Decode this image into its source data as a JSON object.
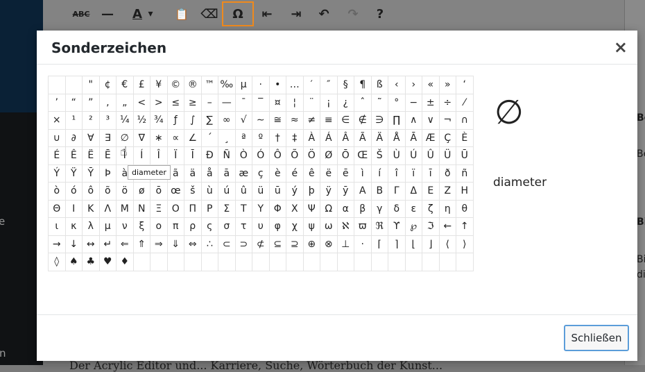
{
  "toolbar": {
    "buttons": [
      {
        "name": "strikethrough-button",
        "glyph": "ABC"
      },
      {
        "name": "horizontal-line-button",
        "glyph": "—"
      },
      {
        "name": "text-color-button",
        "glyph": "A"
      },
      {
        "name": "text-color-dropdown",
        "glyph": "▾"
      },
      {
        "name": "paste-as-text-button",
        "glyph": "📋"
      },
      {
        "name": "clear-formatting-button",
        "glyph": "⌫"
      },
      {
        "name": "special-character-button",
        "glyph": "Ω"
      },
      {
        "name": "decrease-indent-button",
        "glyph": "⇤"
      },
      {
        "name": "increase-indent-button",
        "glyph": "⇥"
      },
      {
        "name": "undo-button",
        "glyph": "↶"
      },
      {
        "name": "redo-button",
        "glyph": "↷"
      },
      {
        "name": "help-button",
        "glyph": "?"
      }
    ]
  },
  "background": {
    "right_letters": [
      "Be",
      "Be",
      "Bi",
      "Bi",
      "di"
    ],
    "sidebar_letters": [
      "e",
      "n"
    ],
    "bottom_text": "Der Acrylic Editor und... Karriere, Suche, Wörterbuch der Kunst..."
  },
  "dialog": {
    "title": "Sonderzeichen",
    "close_glyph": "×",
    "preview_glyph": "∅",
    "preview_name": "diameter",
    "tooltip": "diameter",
    "close_button": "Schließen"
  },
  "characters": [
    [
      "",
      "",
      "\"",
      "¢",
      "€",
      "£",
      "¥",
      "©",
      "®",
      "™",
      "‰",
      "µ",
      "·",
      "•",
      "…",
      "′",
      "″",
      "§",
      "¶",
      "ß",
      "‹",
      "›",
      "«",
      "»",
      "‘"
    ],
    [
      "’",
      "“",
      "”",
      "‚",
      "„",
      "<",
      ">",
      "≤",
      "≥",
      "–",
      "—",
      "¯",
      "‾",
      "¤",
      "¦",
      "¨",
      "¡",
      "¿",
      "ˆ",
      "˜",
      "°",
      "−",
      "±",
      "÷",
      "⁄"
    ],
    [
      "×",
      "¹",
      "²",
      "³",
      "¼",
      "½",
      "¾",
      "ƒ",
      "∫",
      "∑",
      "∞",
      "√",
      "∼",
      "≅",
      "≈",
      "≠",
      "≡",
      "∈",
      "∉",
      "∋",
      "∏",
      "∧",
      "∨",
      "¬",
      "∩"
    ],
    [
      "∪",
      "∂",
      "∀",
      "∃",
      "∅",
      "∇",
      "∗",
      "∝",
      "∠",
      "´",
      "¸",
      "ª",
      "º",
      "†",
      "‡",
      "À",
      "Á",
      "Â",
      "Ã",
      "Ä",
      "Å",
      "Ā",
      "Æ",
      "Ç",
      "È"
    ],
    [
      "É",
      "Ê",
      "Ë",
      "Ē",
      "Ì",
      "Í",
      "Î",
      "Ï",
      "Ī",
      "Ð",
      "Ñ",
      "Ò",
      "Ó",
      "Ô",
      "Õ",
      "Ö",
      "Ø",
      "Ō",
      "Œ",
      "Š",
      "Ù",
      "Ú",
      "Û",
      "Ü",
      "Ū"
    ],
    [
      "Ý",
      "Ÿ",
      "Ȳ",
      "Þ",
      "à",
      "á",
      "â",
      "ã",
      "ä",
      "å",
      "ā",
      "æ",
      "ç",
      "è",
      "é",
      "ê",
      "ë",
      "ē",
      "ì",
      "í",
      "î",
      "ï",
      "ī",
      "ð",
      "ñ"
    ],
    [
      "ò",
      "ó",
      "ô",
      "õ",
      "ö",
      "ø",
      "ō",
      "œ",
      "š",
      "ù",
      "ú",
      "û",
      "ü",
      "ū",
      "ý",
      "þ",
      "ÿ",
      "ȳ",
      "Α",
      "Β",
      "Γ",
      "Δ",
      "Ε",
      "Ζ",
      "Η"
    ],
    [
      "Θ",
      "Ι",
      "Κ",
      "Λ",
      "Μ",
      "Ν",
      "Ξ",
      "Ο",
      "Π",
      "Ρ",
      "Σ",
      "Τ",
      "Υ",
      "Φ",
      "Χ",
      "Ψ",
      "Ω",
      "α",
      "β",
      "γ",
      "δ",
      "ε",
      "ζ",
      "η",
      "θ"
    ],
    [
      "ι",
      "κ",
      "λ",
      "μ",
      "ν",
      "ξ",
      "ο",
      "π",
      "ρ",
      "ς",
      "σ",
      "τ",
      "υ",
      "φ",
      "χ",
      "ψ",
      "ω",
      "ℵ",
      "ϖ",
      "ℜ",
      "ϒ",
      "℘",
      "ℑ",
      "←",
      "↑"
    ],
    [
      "→",
      "↓",
      "↔",
      "↵",
      "⇐",
      "⇑",
      "⇒",
      "⇓",
      "⇔",
      "∴",
      "⊂",
      "⊃",
      "⊄",
      "⊆",
      "⊇",
      "⊕",
      "⊗",
      "⊥",
      "⋅",
      "⌈",
      "⌉",
      "⌊",
      "⌋",
      "⟨",
      "⟩"
    ],
    [
      "◊",
      "♠",
      "♣",
      "♥",
      "♦",
      "",
      "",
      "",
      "",
      "",
      "",
      "",
      "",
      "",
      "",
      "",
      "",
      "",
      "",
      "",
      "",
      "",
      "",
      "",
      ""
    ]
  ]
}
